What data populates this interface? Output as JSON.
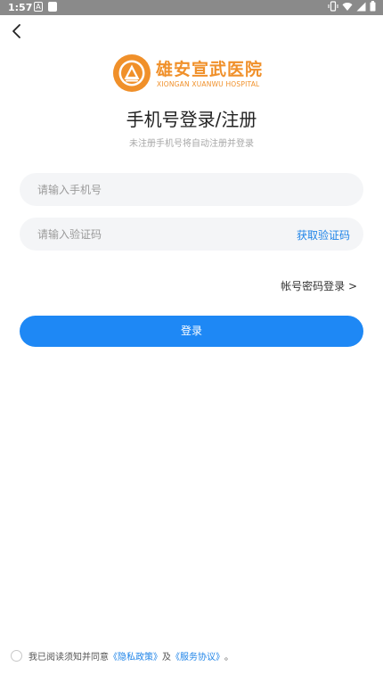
{
  "status_bar": {
    "time": "1:57",
    "notif_a": "A"
  },
  "logo": {
    "name_cn": "雄安宣武医院",
    "name_en": "XIONGAN XUANWU HOSPITAL",
    "color": "#f0902a"
  },
  "page": {
    "title": "手机号登录/注册",
    "subtitle": "未注册手机号将自动注册并登录"
  },
  "form": {
    "phone_placeholder": "请输入手机号",
    "code_placeholder": "请输入验证码",
    "get_code_label": "获取验证码",
    "password_login_label": "帐号密码登录 >",
    "login_label": "登录"
  },
  "agreement": {
    "prefix": "我已阅读须知并同意",
    "privacy_link": "《隐私政策》",
    "and": "及",
    "service_link": "《服务协议》",
    "suffix": "。"
  },
  "colors": {
    "accent": "#1e88f5",
    "link": "#1f84e8",
    "field_bg": "#f4f5f7"
  }
}
